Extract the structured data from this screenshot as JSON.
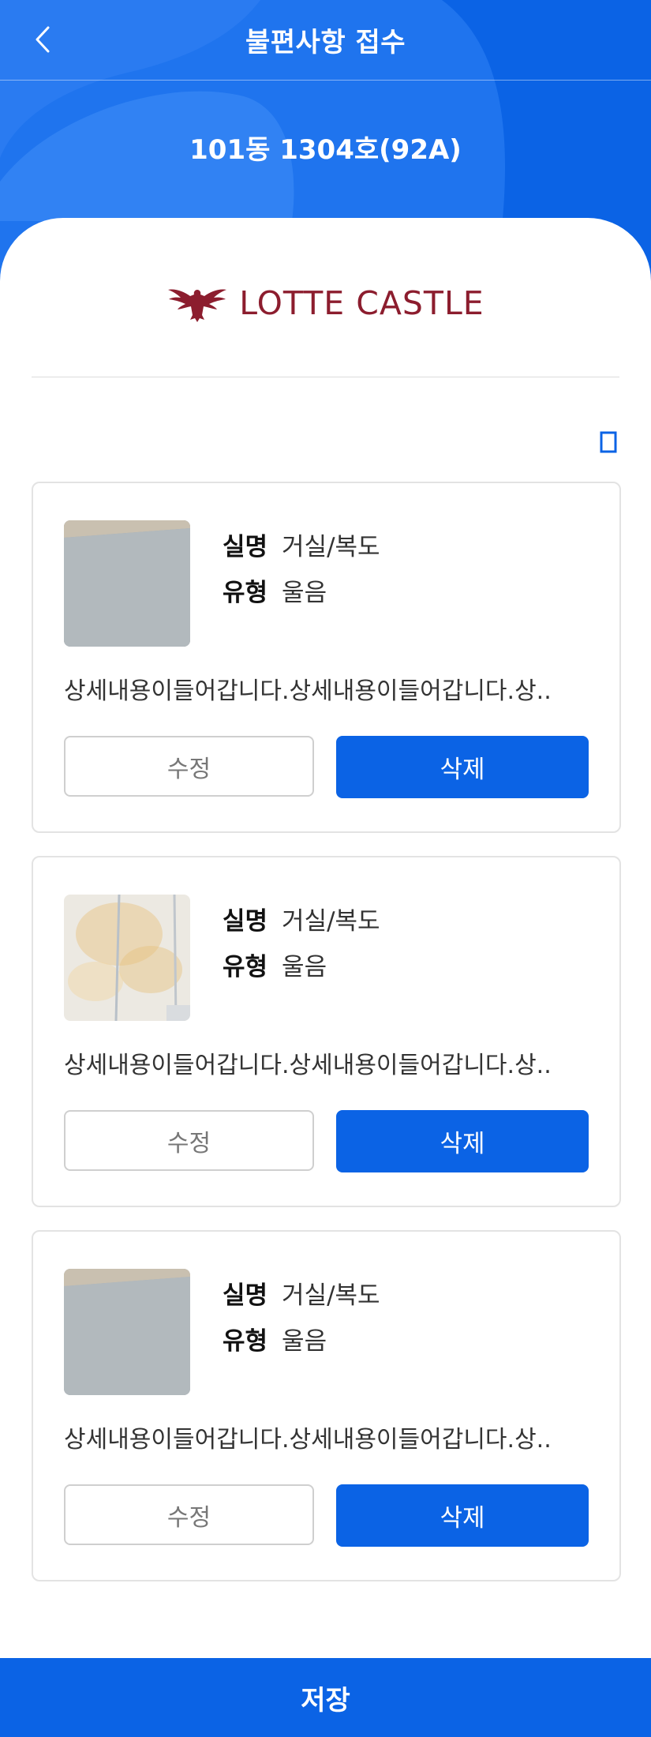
{
  "header": {
    "title": "불편사항 접수",
    "unit": "101동 1304호(92A)"
  },
  "brand": {
    "name": "LOTTE CASTLE",
    "color": "#8c1d2e"
  },
  "icons": {
    "back": "chevron-left-icon",
    "trash": "trash-icon"
  },
  "colors": {
    "primary": "#0b63e5",
    "border": "#e3e3e3"
  },
  "complaints": [
    {
      "room_label": "실명",
      "room": "거실/복도",
      "type_label": "유형",
      "type": "울음",
      "description": "상세내용이들어갑니다.상세내용이들어갑니다.상..",
      "edit": "수정",
      "delete": "삭제"
    },
    {
      "room_label": "실명",
      "room": "거실/복도",
      "type_label": "유형",
      "type": "울음",
      "description": "상세내용이들어갑니다.상세내용이들어갑니다.상..",
      "edit": "수정",
      "delete": "삭제"
    },
    {
      "room_label": "실명",
      "room": "거실/복도",
      "type_label": "유형",
      "type": "울음",
      "description": "상세내용이들어갑니다.상세내용이들어갑니다.상..",
      "edit": "수정",
      "delete": "삭제"
    }
  ],
  "footer": {
    "save": "저장"
  }
}
